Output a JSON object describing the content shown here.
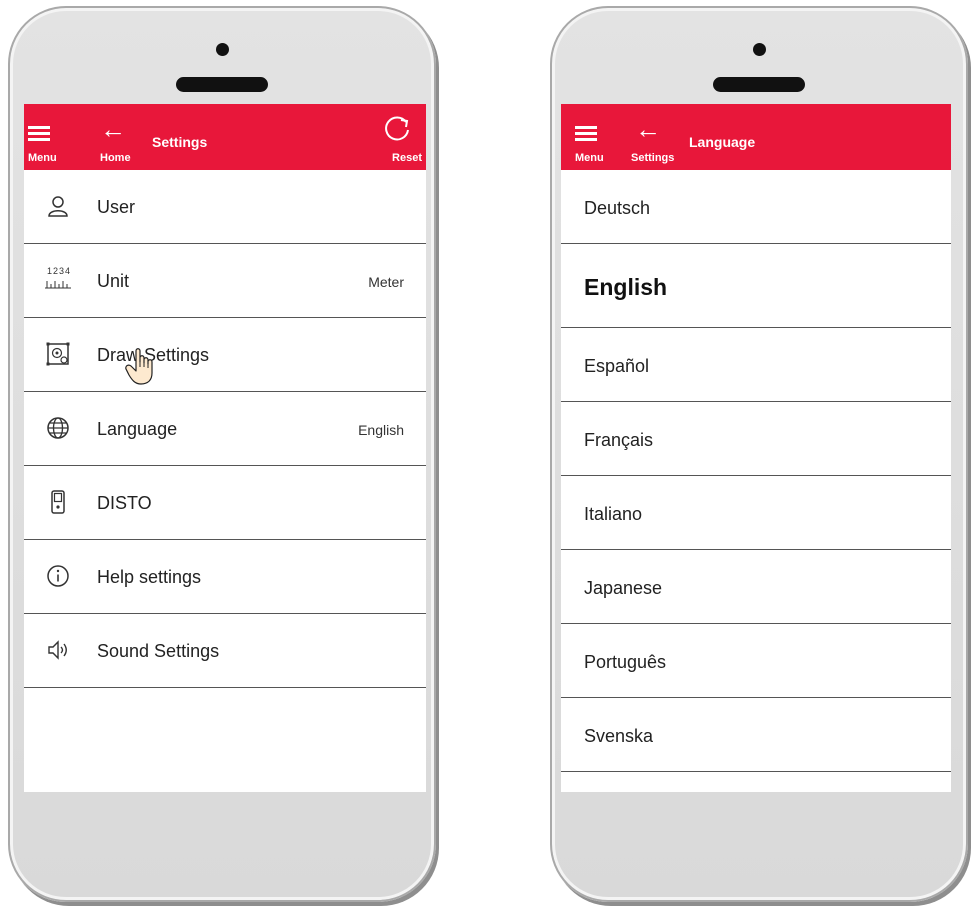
{
  "settings_screen": {
    "topbar": {
      "title": "Settings",
      "menu_label": "Menu",
      "back_label": "Home",
      "reset_label": "Reset"
    },
    "items": [
      {
        "label": "User",
        "value": "",
        "icon": "user-icon"
      },
      {
        "label": "Unit",
        "value": "Meter",
        "icon": "ruler-icon"
      },
      {
        "label": "Draw Settings",
        "value": "",
        "icon": "draw-settings-icon"
      },
      {
        "label": "Language",
        "value": "English",
        "icon": "globe-icon"
      },
      {
        "label": "DISTO",
        "value": "",
        "icon": "disto-device-icon"
      },
      {
        "label": "Help settings",
        "value": "",
        "icon": "info-icon"
      },
      {
        "label": "Sound Settings",
        "value": "",
        "icon": "speaker-icon"
      }
    ],
    "ruler_digits": "1234"
  },
  "language_screen": {
    "topbar": {
      "title": "Language",
      "menu_label": "Menu",
      "back_label": "Settings"
    },
    "languages": [
      "Deutsch",
      "English",
      "Español",
      "Français",
      "Italiano",
      "Japanese",
      "Português",
      "Svenska"
    ],
    "selected": "English"
  },
  "colors": {
    "accent": "#e8173a",
    "phone_body": "#dddddd",
    "divider": "#555555"
  }
}
